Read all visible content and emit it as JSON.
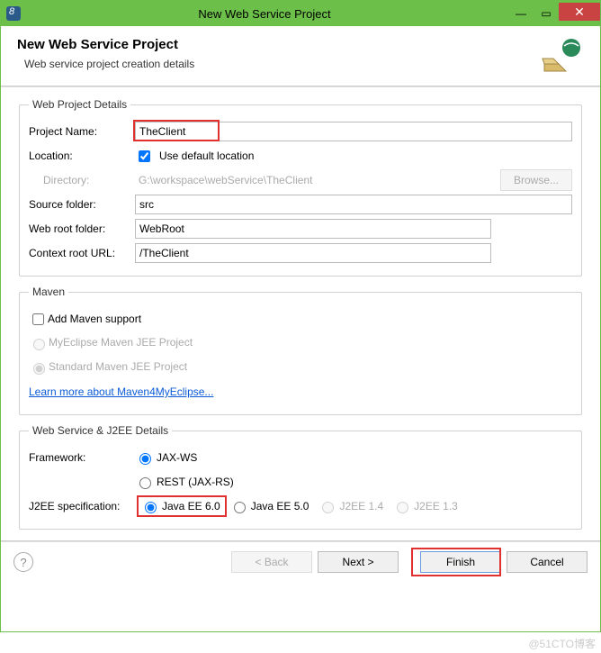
{
  "titlebar": {
    "title": "New Web Service Project"
  },
  "header": {
    "h1": "New Web Service Project",
    "h2": "Web service project creation details"
  },
  "details": {
    "legend": "Web Project Details",
    "projectNameLabel": "Project Name:",
    "projectName": "TheClient",
    "locationLabel": "Location:",
    "useDefaultLabel": "Use default location",
    "directoryLabel": "Directory:",
    "directory": "G:\\workspace\\webService\\TheClient",
    "browse": "Browse...",
    "sourceFolderLabel": "Source folder:",
    "sourceFolder": "src",
    "webRootLabel": "Web root folder:",
    "webRoot": "WebRoot",
    "contextRootLabel": "Context root URL:",
    "contextRoot": "/TheClient"
  },
  "maven": {
    "legend": "Maven",
    "addSupport": "Add Maven support",
    "opt1": "MyEclipse Maven JEE Project",
    "opt2": "Standard Maven JEE Project",
    "link": "Learn more about Maven4MyEclipse..."
  },
  "wsj2ee": {
    "legend": "Web Service & J2EE Details",
    "frameworkLabel": "Framework:",
    "fw1": "JAX-WS",
    "fw2": "REST (JAX-RS)",
    "specLabel": "J2EE specification:",
    "spec1": "Java EE 6.0",
    "spec2": "Java EE 5.0",
    "spec3": "J2EE 1.4",
    "spec4": "J2EE 1.3"
  },
  "footer": {
    "back": "< Back",
    "next": "Next >",
    "finish": "Finish",
    "cancel": "Cancel"
  },
  "watermark": "@51CTO博客"
}
